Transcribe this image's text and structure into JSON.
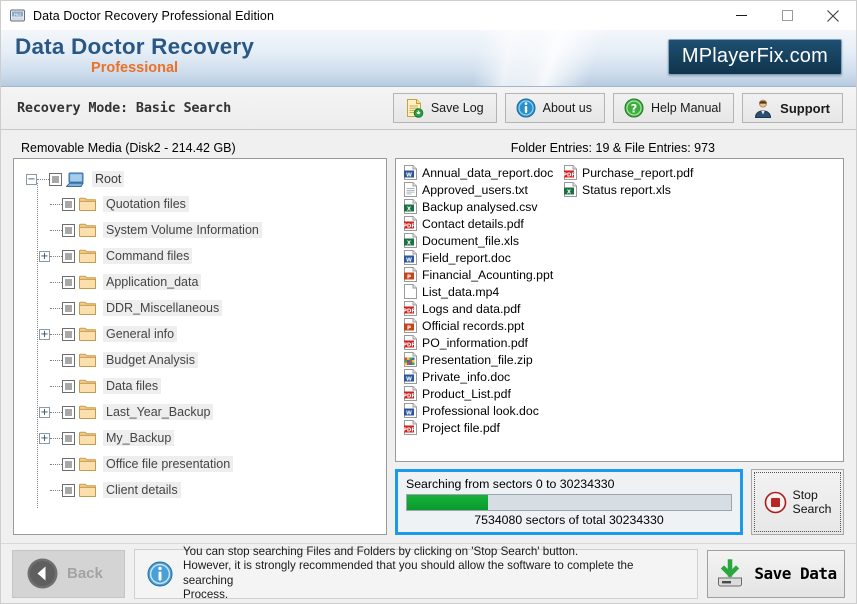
{
  "window": {
    "title": "Data Doctor Recovery Professional Edition",
    "icon": "drive-icon",
    "controls": {
      "minimize": "–",
      "maximize": "□",
      "close": "✕"
    }
  },
  "header": {
    "brand_main": "Data Doctor Recovery",
    "brand_sub": "Professional",
    "logo": "MPlayerFix.com",
    "brand_color": "#2a5885",
    "sub_color": "#ec7026",
    "logo_bg": "#17425f"
  },
  "toolbar": {
    "mode_label": "Recovery Mode: Basic Search",
    "buttons": [
      {
        "label": "Save Log",
        "icon": "save-log-icon"
      },
      {
        "label": "About us",
        "icon": "info-icon"
      },
      {
        "label": "Help Manual",
        "icon": "question-icon"
      },
      {
        "label": "Support",
        "icon": "support-person-icon"
      }
    ]
  },
  "main": {
    "media_label": "Removable Media (Disk2 - 214.42 GB)",
    "entries_label": "Folder Entries: 19 & File Entries: 973"
  },
  "tree": {
    "root": {
      "label": "Root",
      "icon": "computer-icon",
      "expander": "−",
      "checked": true
    },
    "nodes": [
      {
        "label": "Quotation files",
        "expander": "",
        "checked": true
      },
      {
        "label": "System Volume Information",
        "expander": "",
        "checked": true
      },
      {
        "label": "Command files",
        "expander": "+",
        "checked": true
      },
      {
        "label": "Application_data",
        "expander": "",
        "checked": true
      },
      {
        "label": "DDR_Miscellaneous",
        "expander": "",
        "checked": true
      },
      {
        "label": "General info",
        "expander": "+",
        "checked": true
      },
      {
        "label": "Budget Analysis",
        "expander": "",
        "checked": true
      },
      {
        "label": "Data files",
        "expander": "",
        "checked": true
      },
      {
        "label": "Last_Year_Backup",
        "expander": "+",
        "checked": true
      },
      {
        "label": "My_Backup",
        "expander": "+",
        "checked": true
      },
      {
        "label": "Office file presentation",
        "expander": "",
        "checked": true
      },
      {
        "label": "Client details",
        "expander": "",
        "checked": true
      }
    ]
  },
  "files": [
    {
      "name": "Annual_data_report.doc",
      "icon": "word-icon"
    },
    {
      "name": "Approved_users.txt",
      "icon": "text-icon"
    },
    {
      "name": "Backup analysed.csv",
      "icon": "excel-icon"
    },
    {
      "name": "Contact details.pdf",
      "icon": "pdf-icon"
    },
    {
      "name": "Document_file.xls",
      "icon": "excel-icon"
    },
    {
      "name": "Field_report.doc",
      "icon": "word-icon"
    },
    {
      "name": "Financial_Acounting.ppt",
      "icon": "powerpoint-icon"
    },
    {
      "name": "List_data.mp4",
      "icon": "blank-file-icon"
    },
    {
      "name": "Logs and data.pdf",
      "icon": "pdf-icon"
    },
    {
      "name": "Official records.ppt",
      "icon": "powerpoint-icon"
    },
    {
      "name": "PO_information.pdf",
      "icon": "pdf-icon"
    },
    {
      "name": "Presentation_file.zip",
      "icon": "zip-icon"
    },
    {
      "name": "Private_info.doc",
      "icon": "word-icon"
    },
    {
      "name": "Product_List.pdf",
      "icon": "pdf-icon"
    },
    {
      "name": "Professional look.doc",
      "icon": "word-icon"
    },
    {
      "name": "Project file.pdf",
      "icon": "pdf-icon"
    },
    {
      "name": "Purchase_report.pdf",
      "icon": "pdf-icon"
    },
    {
      "name": "Status report.xls",
      "icon": "excel-icon"
    }
  ],
  "progress": {
    "top_text": "Searching from sectors  0 to 30234330",
    "bottom_text": "7534080  sectors  of  total 30234330",
    "current_sectors": 7534080,
    "total_sectors": 30234330,
    "percent": 25,
    "fill_color": "#0e9e2f",
    "border_color": "#1a9ae8",
    "stop_button": {
      "line1": "Stop",
      "line2": "Search",
      "icon": "stop-icon"
    }
  },
  "footer": {
    "back_label": "Back",
    "notice_icon": "info-icon",
    "notice_line1": "You can stop searching Files and Folders by clicking on 'Stop Search' button.",
    "notice_line2": "However, it is strongly recommended that you should allow the software to complete the searching",
    "notice_line3": "Process.",
    "save_label": "Save Data",
    "save_icon": "save-data-icon"
  }
}
